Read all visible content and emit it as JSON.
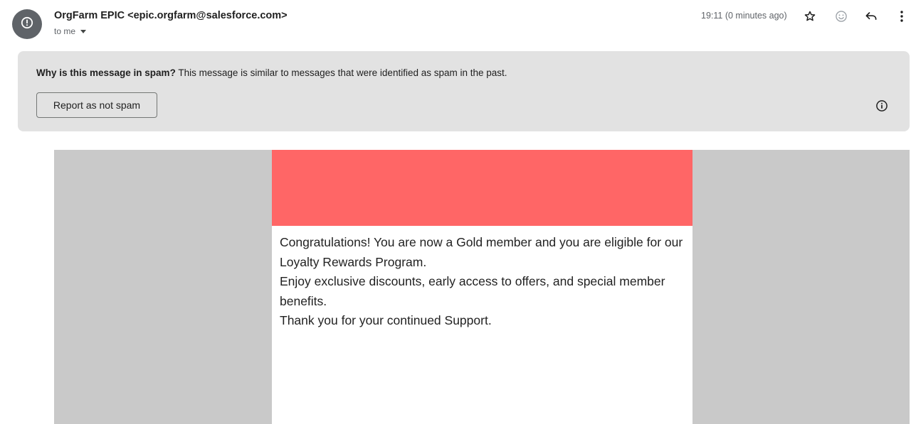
{
  "header": {
    "sender_name": "OrgFarm EPIC",
    "sender_email": "<epic.orgfarm@salesforce.com>",
    "recipient": "to me",
    "timestamp": "19:11 (0 minutes ago)",
    "icons": [
      "alert-icon",
      "star-icon",
      "emoji-icon",
      "reply-icon",
      "more-vert-icon"
    ]
  },
  "spam_banner": {
    "question": "Why is this message in spam?",
    "explanation": "This message is similar to messages that were identified as spam in the past.",
    "button_label": "Report as not spam",
    "icon": "info-icon"
  },
  "email": {
    "hero_color": "#ff6666",
    "paragraphs": [
      "Congratulations! You are now a Gold member and you are eligible for our Loyalty Rewards Program.",
      "Enjoy exclusive discounts, early access to offers, and special member benefits.",
      "Thank you for your continued Support."
    ]
  },
  "colors": {
    "banner_bg": "#e2e2e2",
    "email_outer_bg": "#c9c9c9",
    "avatar_bg": "#5f6368"
  }
}
